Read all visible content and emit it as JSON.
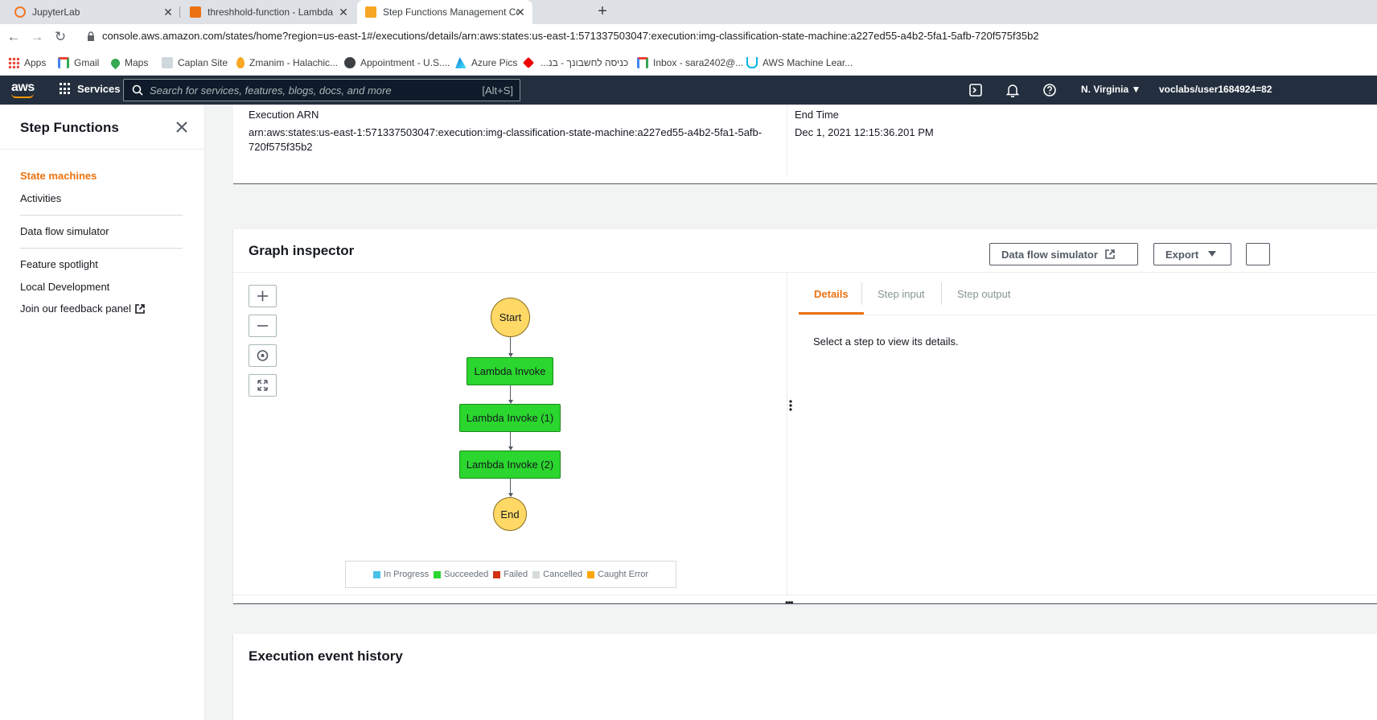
{
  "browser": {
    "tabs": [
      {
        "title": "JupyterLab",
        "active": false
      },
      {
        "title": "threshhold-function - Lambda",
        "active": false
      },
      {
        "title": "Step Functions Management Con",
        "active": true
      }
    ],
    "url": "console.aws.amazon.com/states/home?region=us-east-1#/executions/details/arn:aws:states:us-east-1:571337503047:execution:img-classification-state-machine:a227ed55-a4b2-5fa1-5afb-720f575f35b2",
    "bookmarks": [
      {
        "label": "Apps"
      },
      {
        "label": "Gmail"
      },
      {
        "label": "Maps"
      },
      {
        "label": "Caplan Site"
      },
      {
        "label": "Zmanim - Halachic..."
      },
      {
        "label": "Appointment - U.S...."
      },
      {
        "label": "Azure Pics"
      },
      {
        "label": "כניסה לחשבונך - בנ..."
      },
      {
        "label": "Inbox - sara2402@..."
      },
      {
        "label": "AWS Machine Lear..."
      }
    ]
  },
  "aws_header": {
    "logo": "aws",
    "services_label": "Services",
    "search_placeholder": "Search for services, features, blogs, docs, and more",
    "search_shortcut": "[Alt+S]",
    "region": "N. Virginia ▼",
    "user": "voclabs/user1684924=82"
  },
  "sidebar": {
    "title": "Step Functions",
    "items": [
      {
        "label": "State machines",
        "active": true
      },
      {
        "label": "Activities"
      },
      {
        "label": "Data flow simulator"
      },
      {
        "label": "Feature spotlight"
      },
      {
        "label": "Local Development"
      },
      {
        "label": "Join our feedback panel"
      }
    ]
  },
  "summary": {
    "arn_label": "Execution ARN",
    "arn_line1": "arn:aws:states:us-east-1:571337503047:execution:img-classification-state-machine:a227ed55-a4b2-5fa1-5afb-",
    "arn_line2": "720f575f35b2",
    "end_time_label": "End Time",
    "end_time_value": "Dec 1, 2021 12:15:36.201 PM"
  },
  "graph_inspector": {
    "title": "Graph inspector",
    "data_flow_button": "Data flow simulator",
    "export_button": "Export",
    "nodes": [
      "Start",
      "Lambda Invoke",
      "Lambda Invoke (1)",
      "Lambda Invoke (2)",
      "End"
    ],
    "legend": [
      {
        "label": "In Progress",
        "color": "#48c1e8"
      },
      {
        "label": "Succeeded",
        "color": "#2bd62e"
      },
      {
        "label": "Failed",
        "color": "#d13212"
      },
      {
        "label": "Cancelled",
        "color": "#d5dbdb"
      },
      {
        "label": "Caught Error",
        "color": "#ffa500"
      }
    ],
    "details_tabs": [
      "Details",
      "Step input",
      "Step output"
    ],
    "details_message": "Select a step to view its details."
  },
  "history": {
    "title": "Execution event history"
  }
}
